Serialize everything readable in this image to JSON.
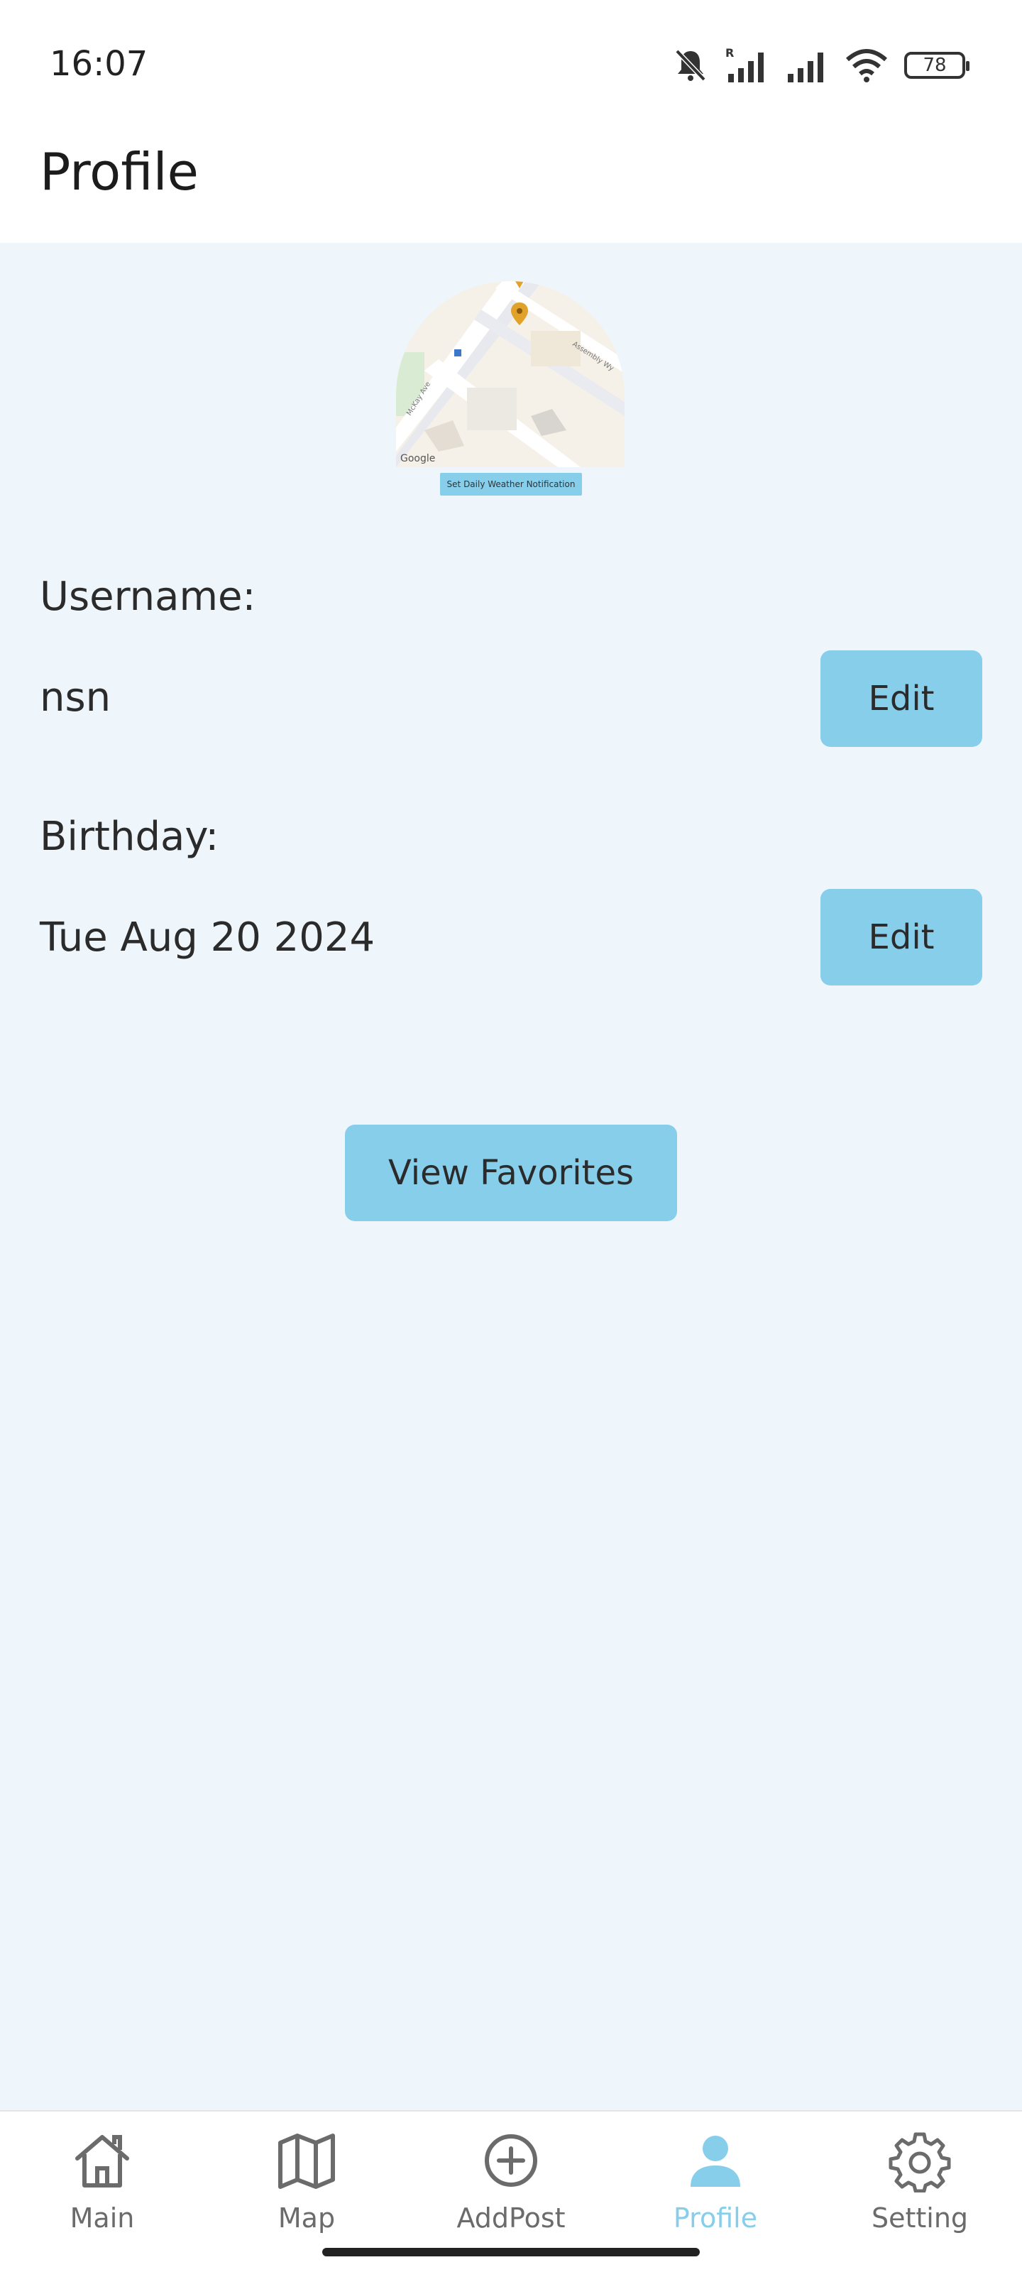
{
  "status_bar": {
    "time": "16:07",
    "battery": "78",
    "icons": [
      "silent-bell-icon",
      "signal-roaming-icon",
      "signal-icon",
      "wifi-icon",
      "battery-icon"
    ]
  },
  "header": {
    "title": "Profile"
  },
  "map": {
    "attribution": "Google",
    "icons": [
      "map-pin-icon"
    ],
    "notify_button": "Set Daily Weather Notification"
  },
  "profile": {
    "username_label": "Username:",
    "username_value": "nsn",
    "username_edit": "Edit",
    "birthday_label": "Birthday:",
    "birthday_value": "Tue Aug 20 2024",
    "birthday_edit": "Edit",
    "favorites_button": "View Favorites"
  },
  "colors": {
    "accent": "#87ceeb",
    "background": "#eef6fc",
    "nav_inactive": "#6b6b6b"
  },
  "nav": {
    "items": [
      {
        "label": "Main",
        "icon": "home-icon",
        "active": false
      },
      {
        "label": "Map",
        "icon": "map-icon",
        "active": false
      },
      {
        "label": "AddPost",
        "icon": "add-circle-icon",
        "active": false
      },
      {
        "label": "Profile",
        "icon": "person-icon",
        "active": true
      },
      {
        "label": "Setting",
        "icon": "gear-icon",
        "active": false
      }
    ]
  }
}
